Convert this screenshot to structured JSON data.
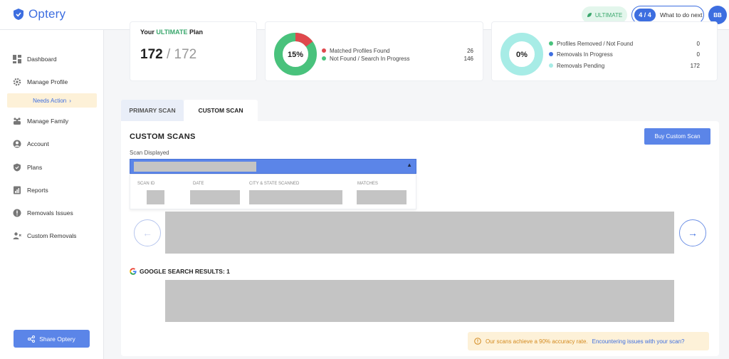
{
  "app": {
    "name": "Optery"
  },
  "header": {
    "plan_badge": "ULTIMATE",
    "progress_count": "4 / 4",
    "progress_label": "What to do next",
    "avatar_initials": "BB"
  },
  "sidebar": {
    "items": [
      {
        "label": "Dashboard",
        "icon": "dashboard-icon"
      },
      {
        "label": "Manage Profile",
        "icon": "gear-icon"
      },
      {
        "label": "Manage Family",
        "icon": "family-icon"
      },
      {
        "label": "Account",
        "icon": "account-icon"
      },
      {
        "label": "Plans",
        "icon": "shield-icon"
      },
      {
        "label": "Reports",
        "icon": "reports-icon"
      },
      {
        "label": "Removals Issues",
        "icon": "alert-icon"
      },
      {
        "label": "Custom Removals",
        "icon": "user-remove-icon"
      }
    ],
    "needs_action": "Needs Action",
    "share_label": "Share Optery"
  },
  "stats": {
    "plan": {
      "title_prefix": "Your",
      "title_highlight": "ULTIMATE",
      "title_suffix": "Plan",
      "used": "172",
      "total": "/ 172"
    },
    "matches": {
      "percent_label": "15%",
      "percent": 15,
      "rows": [
        {
          "label": "Matched Profiles Found",
          "value": "26",
          "color": "#e0484d"
        },
        {
          "label": "Not Found / Search In Progress",
          "value": "146",
          "color": "#49c27c"
        }
      ]
    },
    "removals": {
      "percent_label": "0%",
      "percent": 0,
      "rows": [
        {
          "label": "Profiles Removed / Not Found",
          "value": "0",
          "color": "#49c27c"
        },
        {
          "label": "Removals In Progress",
          "value": "0",
          "color": "#3d6ee0"
        },
        {
          "label": "Removals Pending",
          "value": "172",
          "color": "#a7ece6"
        }
      ]
    }
  },
  "tabs": [
    {
      "label": "PRIMARY SCAN"
    },
    {
      "label": "CUSTOM SCAN"
    }
  ],
  "main": {
    "title": "CUSTOM SCANS",
    "buy_button": "Buy Custom Scan",
    "scan_label": "Scan Displayed",
    "columns": [
      "SCAN ID",
      "DATE",
      "CITY & STATE SCANNED",
      "MATCHES"
    ],
    "google_title": "GOOGLE SEARCH RESULTS: 1",
    "accuracy_text": "Our scans achieve a 90% accuracy rate.",
    "accuracy_link": "Encountering issues with your scan?"
  },
  "colors": {
    "brand": "#3d6ee0",
    "success": "#49c27c",
    "danger": "#e0484d",
    "pending": "#a7ece6"
  }
}
